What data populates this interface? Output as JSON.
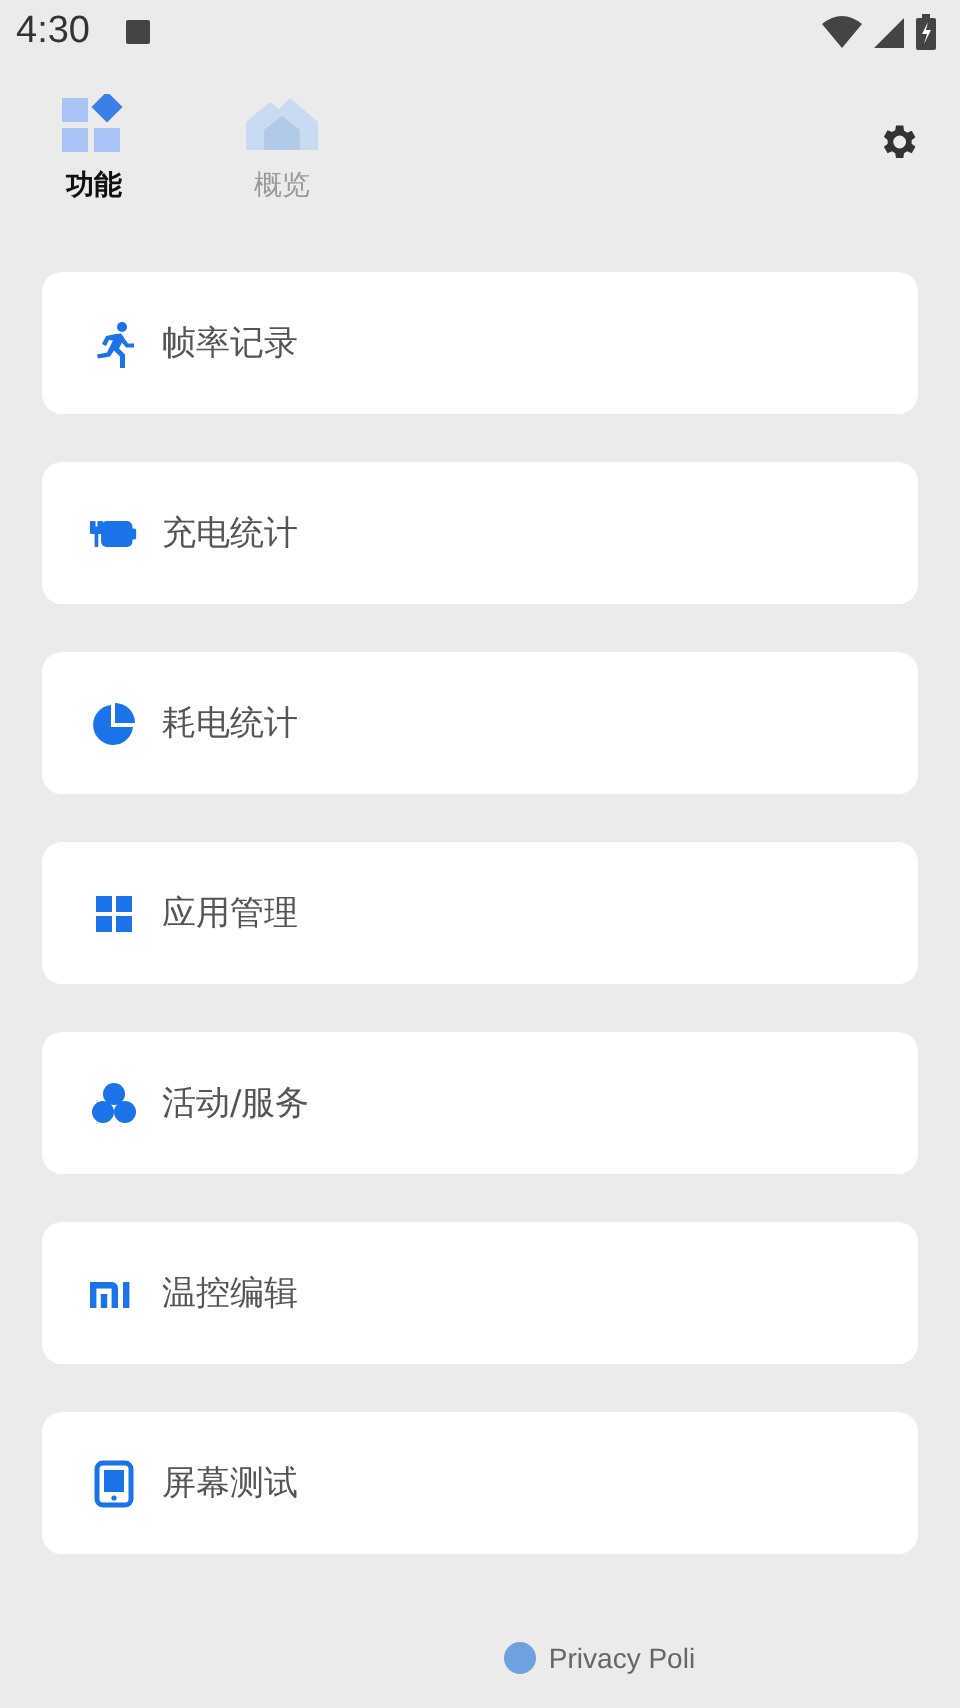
{
  "status_bar": {
    "time": "4:30"
  },
  "tabs": [
    {
      "label": "功能",
      "selected": true
    },
    {
      "label": "概览",
      "selected": false
    }
  ],
  "items": [
    {
      "label": "帧率记录"
    },
    {
      "label": "充电统计"
    },
    {
      "label": "耗电统计"
    },
    {
      "label": "应用管理"
    },
    {
      "label": "活动/服务"
    },
    {
      "label": "温控编辑"
    },
    {
      "label": "屏幕测试"
    }
  ],
  "footer": {
    "link": "Privacy Poli"
  }
}
